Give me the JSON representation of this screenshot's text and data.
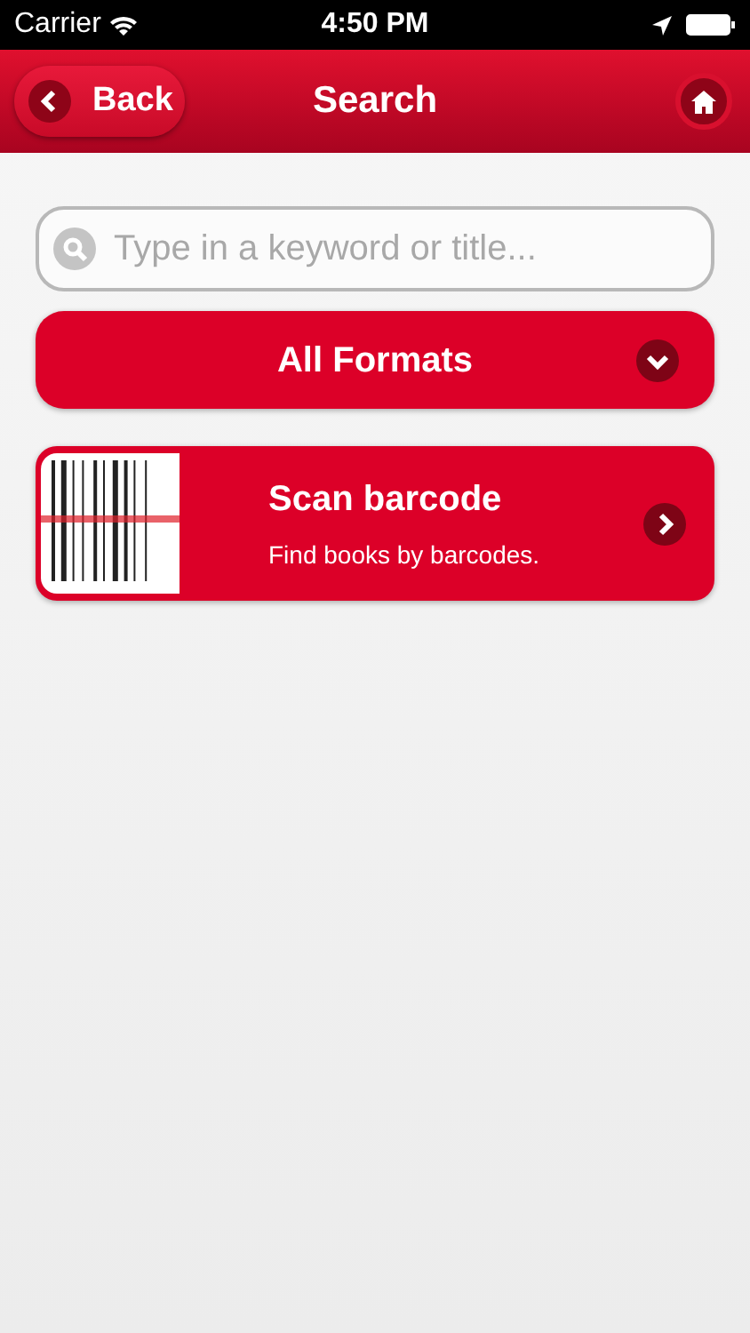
{
  "status_bar": {
    "carrier": "Carrier",
    "time": "4:50 PM"
  },
  "nav_bar": {
    "back_label": "Back",
    "title": "Search"
  },
  "search": {
    "placeholder": "Type in a keyword or title..."
  },
  "format_dropdown": {
    "value": "All Formats"
  },
  "scan_card": {
    "title": "Scan barcode",
    "subtitle": "Find books by barcodes."
  }
}
